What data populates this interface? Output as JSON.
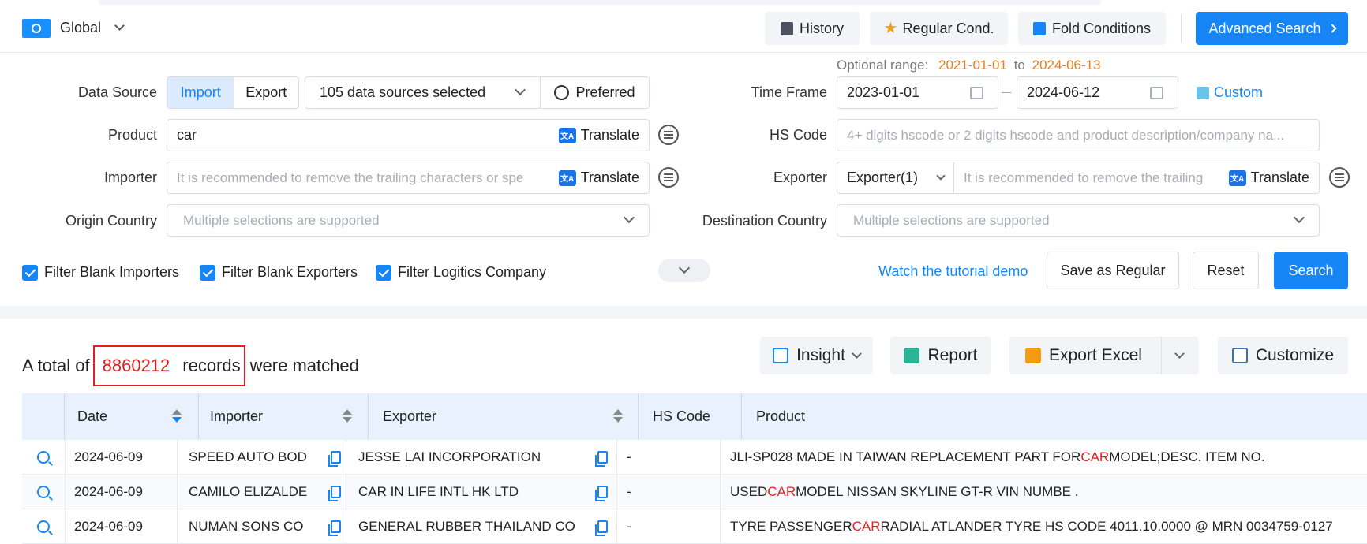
{
  "topbar": {
    "region": "Global",
    "history": "History",
    "regular": "Regular Cond.",
    "fold": "Fold Conditions",
    "advanced": "Advanced Search"
  },
  "form": {
    "optional_range_label": "Optional range:",
    "optional_from": "2021-01-01",
    "optional_to_word": "to",
    "optional_to": "2024-06-13",
    "data_source_label": "Data Source",
    "import": "Import",
    "export": "Export",
    "sources_selected": "105 data sources selected",
    "preferred": "Preferred",
    "time_frame_label": "Time Frame",
    "date_from": "2023-01-01",
    "date_to": "2024-06-12",
    "custom": "Custom",
    "product_label": "Product",
    "product_value": "car",
    "translate": "Translate",
    "hs_code_label": "HS Code",
    "hs_code_placeholder": "4+ digits hscode or 2 digits hscode and product description/company na...",
    "importer_label": "Importer",
    "importer_placeholder": "It is recommended to remove the trailing characters or spe",
    "exporter_label": "Exporter",
    "exporter_select": "Exporter(1)",
    "exporter_placeholder": "It is recommended to remove the trailing",
    "origin_label": "Origin Country",
    "origin_placeholder": "Multiple selections are supported",
    "destination_label": "Destination Country",
    "destination_placeholder": "Multiple selections are supported",
    "filter_importers": "Filter Blank Importers",
    "filter_exporters": "Filter Blank Exporters",
    "filter_logistics": "Filter Logitics Company",
    "tutorial": "Watch the tutorial demo",
    "save_regular": "Save as Regular",
    "reset": "Reset",
    "search": "Search"
  },
  "results": {
    "prefix": "A total of",
    "count": "8860212",
    "records": "records",
    "suffix": "were matched",
    "insight": "Insight",
    "report": "Report",
    "export_excel": "Export Excel",
    "customize": "Customize"
  },
  "table": {
    "headers": {
      "date": "Date",
      "importer": "Importer",
      "exporter": "Exporter",
      "hs_code": "HS Code",
      "product": "Product"
    },
    "rows": [
      {
        "date": "2024-06-09",
        "importer": "SPEED AUTO BOD",
        "exporter": "JESSE LAI INCORPORATION",
        "hs_code": "-",
        "product_pre": "JLI-SP028 MADE IN TAIWAN REPLACEMENT PART FOR ",
        "product_hl": "CAR",
        "product_post": " MODEL;DESC. ITEM NO."
      },
      {
        "date": "2024-06-09",
        "importer": "CAMILO ELIZALDE",
        "exporter": "CAR IN LIFE INTL HK LTD",
        "hs_code": "-",
        "product_pre": "USED ",
        "product_hl": "CAR",
        "product_post": " MODEL NISSAN SKYLINE GT-R VIN NUMBE ."
      },
      {
        "date": "2024-06-09",
        "importer": "NUMAN SONS CO",
        "exporter": "GENERAL RUBBER THAILAND CO",
        "hs_code": "-",
        "product_pre": "TYRE PASSENGER ",
        "product_hl": "CAR",
        "product_post": " RADIAL ATLANDER TYRE HS CODE 4011.10.0000 @ MRN 0034759-0127"
      }
    ]
  }
}
